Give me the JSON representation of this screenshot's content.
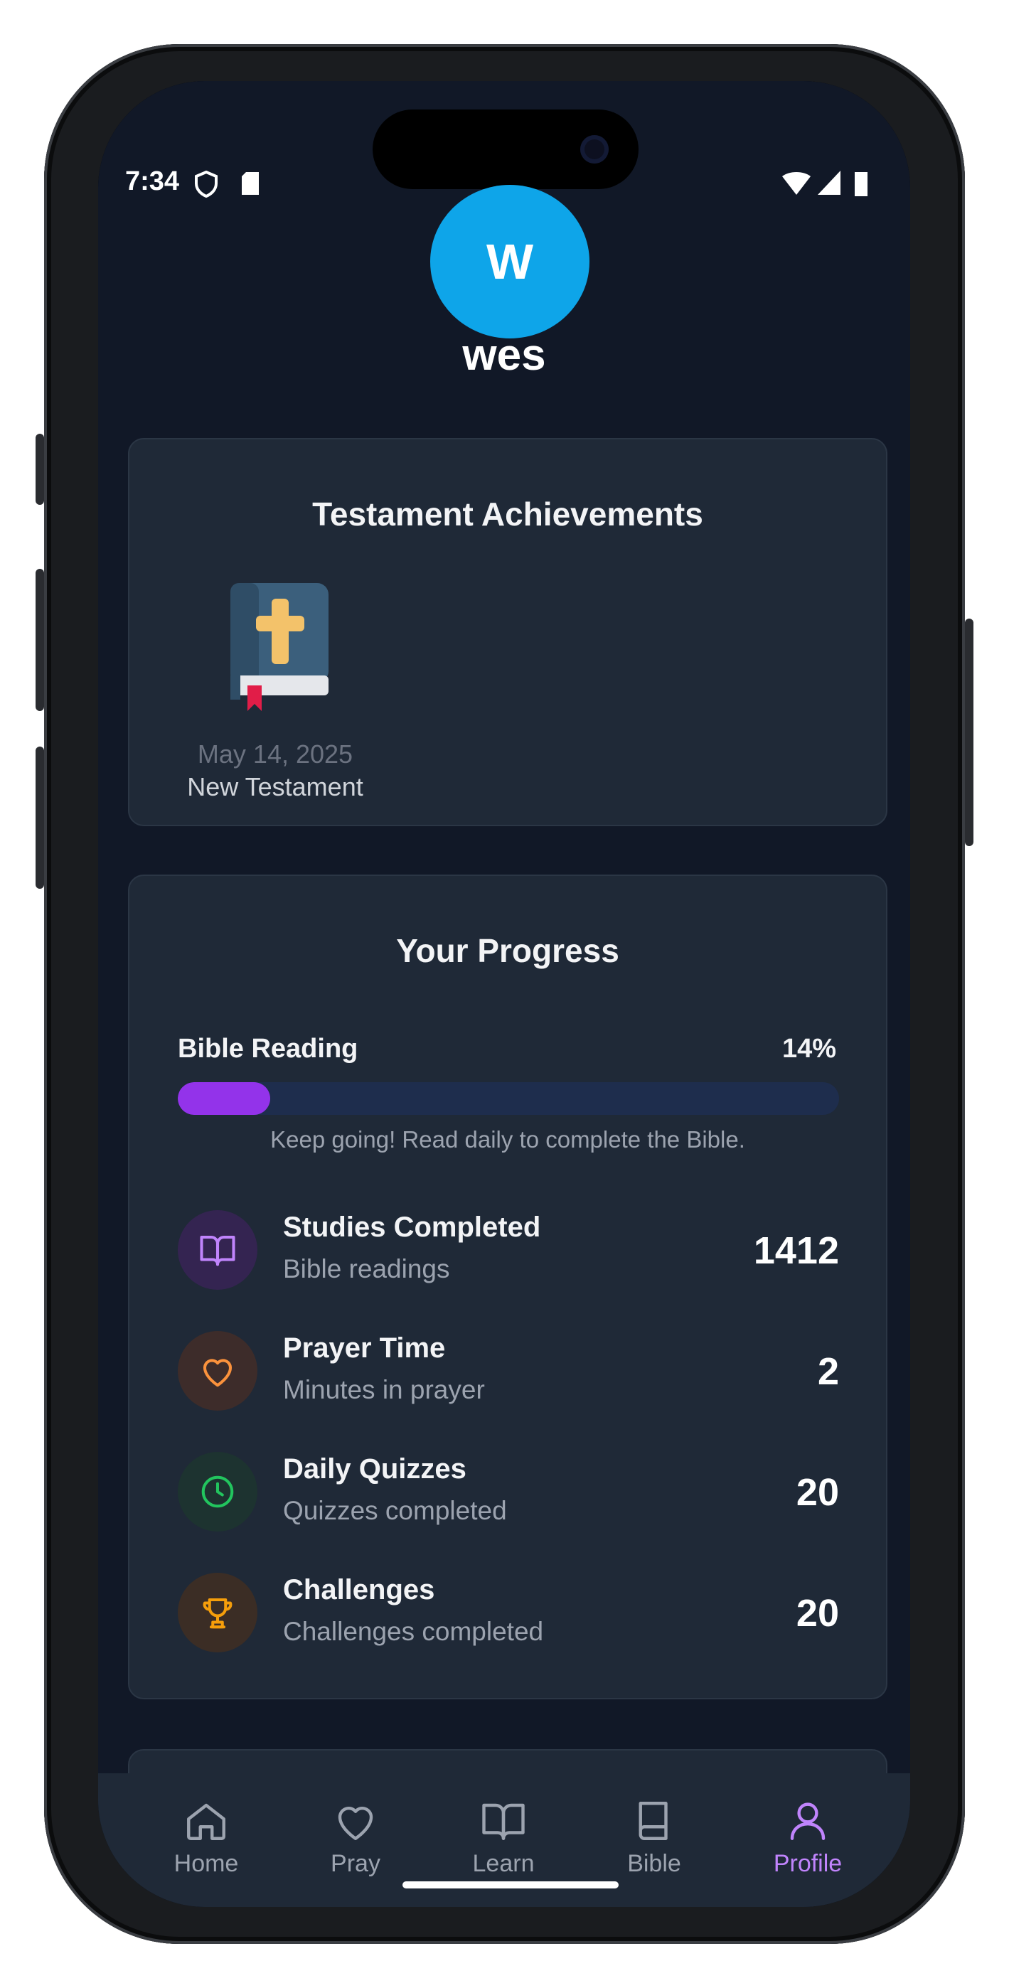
{
  "status_bar": {
    "time": "7:34"
  },
  "profile": {
    "avatar_initial": "W",
    "username": "wes"
  },
  "achievements": {
    "title": "Testament Achievements",
    "items": [
      {
        "date": "May 14, 2025",
        "label": "New Testament",
        "icon": "bible-cross-icon"
      }
    ]
  },
  "progress": {
    "title": "Your Progress",
    "bible_reading": {
      "label": "Bible Reading",
      "percent_label": "14%",
      "percent": 14,
      "message": "Keep going! Read daily to complete the Bible."
    },
    "stats": [
      {
        "title": "Studies Completed",
        "subtitle": "Bible readings",
        "value": "1412",
        "icon": "book-open-icon",
        "color": "#c084fc",
        "bg": "#342451"
      },
      {
        "title": "Prayer Time",
        "subtitle": "Minutes in prayer",
        "value": "2",
        "icon": "heart-icon",
        "color": "#fb923c",
        "bg": "#3d2c2a"
      },
      {
        "title": "Daily Quizzes",
        "subtitle": "Quizzes completed",
        "value": "20",
        "icon": "clock-icon",
        "color": "#22c55e",
        "bg": "#1d3330"
      },
      {
        "title": "Challenges",
        "subtitle": "Challenges completed",
        "value": "20",
        "icon": "trophy-icon",
        "color": "#f59e0b",
        "bg": "#3b2d25"
      }
    ]
  },
  "colors": {
    "background": "#111827",
    "card": "#1f2937",
    "accent": "#9333ea",
    "avatar": "#0ea5e9",
    "active_nav": "#c084fc",
    "inactive_nav": "#9ca3af"
  },
  "nav": [
    {
      "label": "Home",
      "icon": "home-icon",
      "active": false
    },
    {
      "label": "Pray",
      "icon": "heart-icon",
      "active": false
    },
    {
      "label": "Learn",
      "icon": "book-open-icon",
      "active": false
    },
    {
      "label": "Bible",
      "icon": "book-icon",
      "active": false
    },
    {
      "label": "Profile",
      "icon": "user-icon",
      "active": true
    }
  ]
}
